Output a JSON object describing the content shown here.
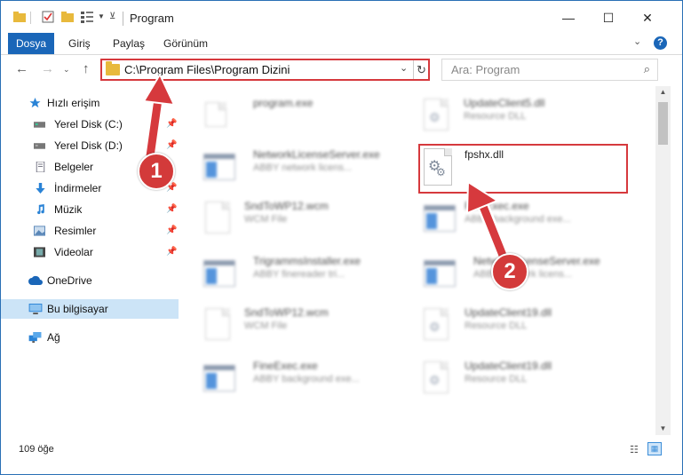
{
  "window": {
    "title": "Program",
    "minimize": "—",
    "maximize": "☐",
    "close": "✕"
  },
  "ribbon": {
    "tabs": [
      "Dosya",
      "Giriş",
      "Paylaş",
      "Görünüm"
    ],
    "help": "?"
  },
  "navigation": {
    "address": "C:\\Program Files\\Program Dizini",
    "search_placeholder": "Ara: Program"
  },
  "sidebar": {
    "items": [
      {
        "label": "Hızlı erişim",
        "icon": "star-icon"
      },
      {
        "label": "Yerel Disk (C:)",
        "icon": "drive-icon"
      },
      {
        "label": "Yerel Disk (D:)",
        "icon": "drive-icon"
      },
      {
        "label": "Belgeler",
        "icon": "documents-icon"
      },
      {
        "label": "İndirmeler",
        "icon": "download-icon"
      },
      {
        "label": "Müzik",
        "icon": "music-icon"
      },
      {
        "label": "Resimler",
        "icon": "pictures-icon"
      },
      {
        "label": "Videolar",
        "icon": "video-icon"
      },
      {
        "label": "OneDrive",
        "icon": "cloud-icon"
      },
      {
        "label": "Bu bilgisayar",
        "icon": "computer-icon"
      },
      {
        "label": "Ağ",
        "icon": "network-icon"
      }
    ]
  },
  "files": [
    {
      "name": "program.exe",
      "sub": ""
    },
    {
      "name": "UpdateClient5.dll",
      "sub": "Resource DLL"
    },
    {
      "name": "NetworkLicenseServer.exe",
      "sub": "ABBY network licens..."
    },
    {
      "name": "fpshx.dll",
      "sub": ""
    },
    {
      "name": "SndToWP12.wcm",
      "sub": "WCM File"
    },
    {
      "name": "FineExec.exe",
      "sub": "ABBY background exe..."
    },
    {
      "name": "TrigrammsInstaller.exe",
      "sub": "ABBY finereader tri..."
    },
    {
      "name": "NetworkLicenseServer.exe",
      "sub": "ABBY network licens..."
    },
    {
      "name": "SndToWP12.wcm",
      "sub": "WCM File"
    },
    {
      "name": "UpdateClient19.dll",
      "sub": "Resource DLL"
    },
    {
      "name": "FineExec.exe",
      "sub": "ABBY background exe..."
    },
    {
      "name": "UpdateClient19.dll",
      "sub": "Resource DLL"
    }
  ],
  "status": {
    "count": "109 öğe"
  },
  "annotations": {
    "step1": "1",
    "step2": "2",
    "color": "#d6393d"
  }
}
